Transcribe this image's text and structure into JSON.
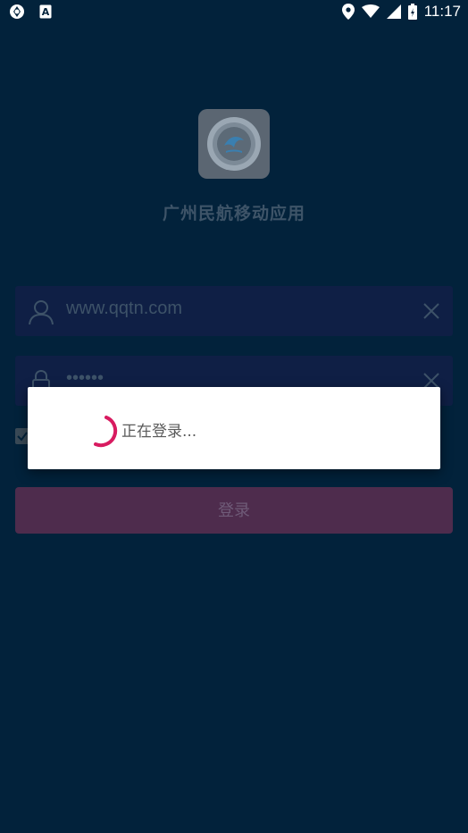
{
  "status_bar": {
    "time": "11:17",
    "left_icons": [
      "sync-icon",
      "a-letter-icon"
    ],
    "right_icons": [
      "location-icon",
      "wifi-icon",
      "signal-icon",
      "battery-icon"
    ]
  },
  "app": {
    "name": "广州民航移动应用",
    "logo_icon": "college-emblem-icon"
  },
  "login_form": {
    "username": {
      "value": "www.qqtn.com",
      "icon": "user-icon",
      "clear_icon": "close-icon"
    },
    "password": {
      "value": "••••••",
      "icon": "lock-icon",
      "clear_icon": "close-icon"
    },
    "remember_checked": true,
    "login_label": "登录"
  },
  "dialog": {
    "message": "正在登录...",
    "spinner_color": "#d81b60"
  },
  "colors": {
    "background": "#02223b",
    "field_bg": "#0f1f45",
    "button_bg": "#4e2c4d",
    "accent": "#d81b60"
  }
}
